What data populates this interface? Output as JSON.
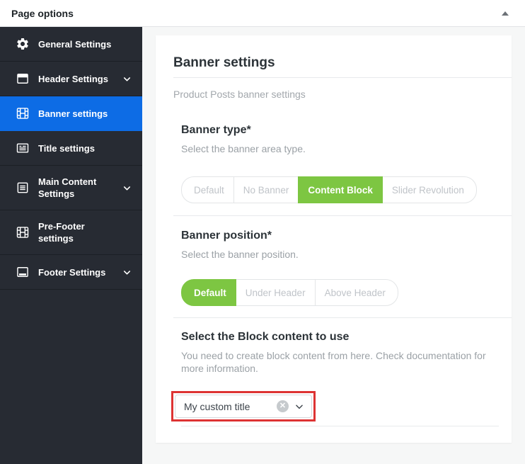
{
  "header": {
    "title": "Page options",
    "collapse_icon": "triangle-up-icon"
  },
  "colors": {
    "sidebar_bg": "#272b33",
    "active_item_blue": "#0d6ce5",
    "active_button_green": "#7dc642",
    "annotation_red": "#dd3333"
  },
  "sidebar": {
    "active_item": "Banner settings",
    "items": [
      {
        "label": "General Settings",
        "icon": "gear-icon",
        "has_chevron": false,
        "active": false
      },
      {
        "label": "Header Settings",
        "icon": "header-window-icon",
        "has_chevron": true,
        "active": false
      },
      {
        "label": "Banner settings",
        "icon": "film-strip-icon",
        "has_chevron": false,
        "active": true
      },
      {
        "label": "Title settings",
        "icon": "title-list-icon",
        "has_chevron": false,
        "active": false
      },
      {
        "label": "Main Content Settings",
        "icon": "document-lines-icon",
        "has_chevron": true,
        "active": false
      },
      {
        "label": "Pre-Footer settings",
        "icon": "film-strip-icon",
        "has_chevron": false,
        "active": false
      },
      {
        "label": "Footer Settings",
        "icon": "footer-window-icon",
        "has_chevron": true,
        "active": false
      }
    ]
  },
  "panel": {
    "title": "Banner settings",
    "subtitle": "Product Posts banner settings",
    "banner_type": {
      "label": "Banner type*",
      "description": "Select the banner area type.",
      "options": [
        "Default",
        "No Banner",
        "Content Block",
        "Slider Revolution"
      ],
      "selected": "Content Block"
    },
    "banner_position": {
      "label": "Banner position*",
      "description": "Select the banner position.",
      "options": [
        "Default",
        "Under Header",
        "Above Header"
      ],
      "selected": "Default"
    },
    "block_content": {
      "label": "Select the Block content to use",
      "description": "You need to create block content from here. Check documentation for more information.",
      "selected_value": "My custom title",
      "clear_icon": "clear-x-icon",
      "dropdown_icon": "chevron-down-icon"
    }
  }
}
